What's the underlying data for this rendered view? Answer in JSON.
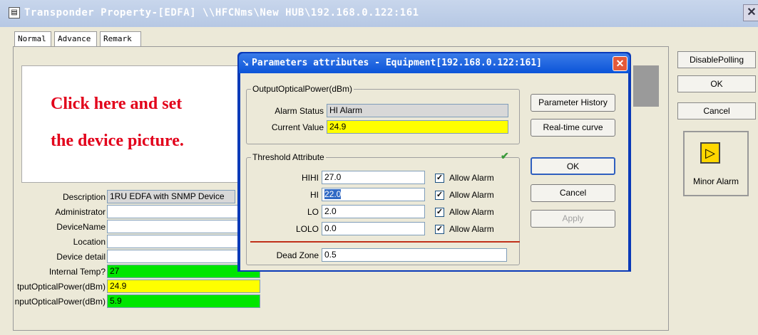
{
  "window": {
    "title": "Transponder Property-[EDFA] \\\\HFCNms\\New HUB\\192.168.0.122:161",
    "tabs": [
      "Normal",
      "Advance",
      "Remark"
    ]
  },
  "picture": {
    "line1": "Click here and set",
    "line2": "the device picture."
  },
  "fields": [
    {
      "label": "Description",
      "value": "1RU EDFA with SNMP Device"
    },
    {
      "label": "Administrator",
      "value": ""
    },
    {
      "label": "DeviceName",
      "value": ""
    },
    {
      "label": "Location",
      "value": ""
    },
    {
      "label": "Device detail",
      "value": ""
    },
    {
      "label": "Internal Temp?",
      "value": "27"
    },
    {
      "label": "tputOpticalPower(dBm)",
      "value": "24.9"
    },
    {
      "label": "nputOpticalPower(dBm)",
      "value": "5.9"
    }
  ],
  "right_panel": {
    "disable_polling": "DisablePolling",
    "ok": "OK",
    "cancel": "Cancel",
    "alarm_label": "Minor Alarm"
  },
  "dialog": {
    "title": "Parameters attributes - Equipment[192.168.0.122:161]",
    "output_group": {
      "title": "OutputOpticalPower(dBm)",
      "alarm_status_label": "Alarm Status",
      "alarm_status_value": "HI Alarm",
      "current_value_label": "Current Value",
      "current_value": "24.9"
    },
    "threshold_group": {
      "title": "Threshold Attribute",
      "rows": [
        {
          "label": "HIHI",
          "value": "27.0",
          "allow": "Allow Alarm",
          "checked": true
        },
        {
          "label": "HI",
          "value": "22.0",
          "allow": "Allow Alarm",
          "checked": true
        },
        {
          "label": "LO",
          "value": "2.0",
          "allow": "Allow Alarm",
          "checked": true
        },
        {
          "label": "LOLO",
          "value": "0.0",
          "allow": "Allow Alarm",
          "checked": true
        }
      ],
      "dead_zone_label": "Dead Zone",
      "dead_zone_value": "0.5"
    },
    "buttons": {
      "parameter_history": "Parameter History",
      "realtime_curve": "Real-time curve",
      "ok": "OK",
      "cancel": "Cancel",
      "apply": "Apply"
    }
  }
}
